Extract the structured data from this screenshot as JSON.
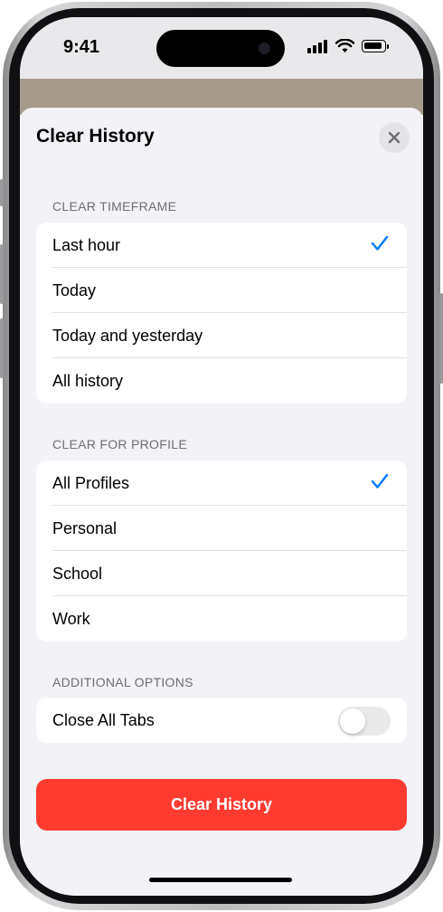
{
  "status": {
    "time": "9:41"
  },
  "sheet": {
    "title": "Clear History",
    "close_icon": "close-icon"
  },
  "sections": {
    "timeframe": {
      "header": "CLEAR TIMEFRAME",
      "options": [
        "Last hour",
        "Today",
        "Today and yesterday",
        "All history"
      ],
      "selected": "Last hour"
    },
    "profile": {
      "header": "CLEAR FOR PROFILE",
      "options": [
        "All Profiles",
        "Personal",
        "School",
        "Work"
      ],
      "selected": "All Profiles"
    },
    "additional": {
      "header": "ADDITIONAL OPTIONS",
      "close_all_tabs_label": "Close All Tabs",
      "close_all_tabs_on": false
    }
  },
  "action": {
    "label": "Clear History"
  },
  "colors": {
    "accent": "#007aff",
    "destructive": "#ff3b30",
    "background": "#f2f2f7"
  }
}
